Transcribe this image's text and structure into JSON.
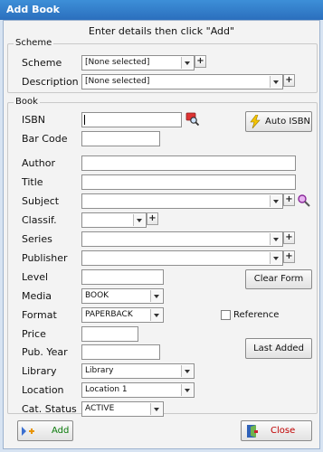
{
  "window": {
    "title": "Add Book"
  },
  "instruction": "Enter details then click \"Add\"",
  "scheme_group": {
    "legend": "Scheme",
    "scheme_label": "Scheme",
    "scheme_value": "[None selected]",
    "description_label": "Description",
    "description_value": "[None selected]"
  },
  "book_group": {
    "legend": "Book",
    "isbn_label": "ISBN",
    "isbn_value": "",
    "auto_isbn_button": "Auto ISBN",
    "barcode_label": "Bar Code",
    "author_label": "Author",
    "title_label": "Title",
    "subject_label": "Subject",
    "classif_label": "Classif.",
    "series_label": "Series",
    "publisher_label": "Publisher",
    "level_label": "Level",
    "clear_form_button": "Clear Form",
    "media_label": "Media",
    "media_value": "BOOK",
    "format_label": "Format",
    "format_value": "PAPERBACK",
    "reference_label": "Reference",
    "price_label": "Price",
    "pub_year_label": "Pub. Year",
    "last_added_button": "Last Added",
    "library_label": "Library",
    "library_value": "Library",
    "location_label": "Location",
    "location_value": "Location 1",
    "cat_status_label": "Cat. Status",
    "cat_status_value": "ACTIVE"
  },
  "footer": {
    "add_button": "Add",
    "close_button": "Close"
  },
  "colors": {
    "titlebar": "#2b6fbd",
    "add_text": "#0a7a0a",
    "close_text": "#c00000"
  },
  "icons": [
    "search-isbn-icon",
    "lightning-icon",
    "magnifier-icon",
    "add-arrow-icon",
    "close-door-icon"
  ]
}
